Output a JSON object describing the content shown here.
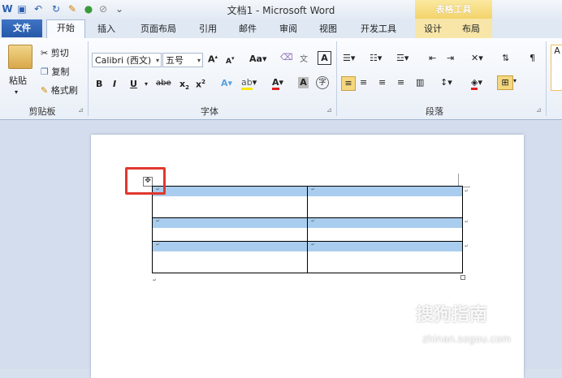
{
  "app": {
    "title": "文档1 - Microsoft Word",
    "contextual_tab_group": "表格工具"
  },
  "tabs": [
    "文件",
    "开始",
    "插入",
    "页面布局",
    "引用",
    "邮件",
    "审阅",
    "视图",
    "开发工具",
    "设计",
    "布局"
  ],
  "ribbon": {
    "clipboard": {
      "label": "剪贴板",
      "paste": "粘贴",
      "cut": "剪切",
      "copy": "复制",
      "format_painter": "格式刷"
    },
    "font": {
      "label": "字体",
      "font_name": "Calibri (西文)",
      "font_size": "五号",
      "grow": "A",
      "shrink": "A",
      "change_case": "Aa",
      "bold": "B",
      "italic": "I",
      "underline": "U",
      "strike": "abe",
      "subscript": "x",
      "superscript": "x"
    },
    "paragraph": {
      "label": "段落"
    },
    "styles": {
      "preview": "A"
    }
  },
  "document": {
    "table_rows": 3,
    "table_cols": 2
  },
  "watermark": {
    "text": "搜狗指南",
    "sub": "zhinan.sogou.com"
  },
  "colors": {
    "file_tab": "#2b5fb0",
    "contextual": "#f3d36b",
    "highlight": "#a9cdee",
    "callout": "#e0382f"
  }
}
